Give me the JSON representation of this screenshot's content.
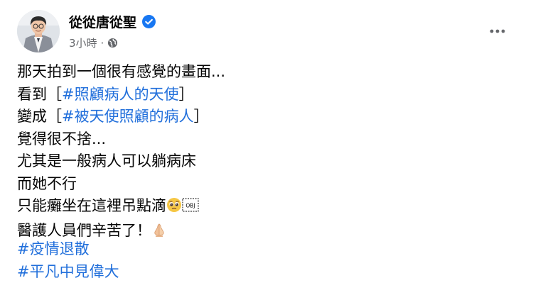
{
  "post": {
    "author": "從從唐從聖",
    "time": "3小時",
    "separator": "·",
    "lines": {
      "l1": "那天拍到一個很有感覺的畫面...",
      "l2_prefix": "看到［",
      "l2_tag": "#照顧病人的天使",
      "l2_suffix": "］",
      "l3_prefix": "變成［",
      "l3_tag": "#被天使照顧的病人",
      "l3_suffix": "］",
      "l4": "覺得很不捨...",
      "l5": "尤其是一般病人可以躺病床",
      "l6": "而她不行",
      "l7": "只能癱坐在這裡吊點滴",
      "l7_obj": "OBJ",
      "l8": "醫護人員們辛苦了！"
    },
    "hashtags": [
      "#疫情退散",
      "#平凡中見偉大"
    ],
    "icons": {
      "verified": "verified-badge-icon",
      "audience": "globe-icon",
      "more": "more-options-icon",
      "emoji_sad": "pleading-face-emoji",
      "emoji_pray": "folded-hands-emoji"
    },
    "colors": {
      "hashtag": "#216fdb",
      "verified": "#1877f2",
      "meta": "#65676b"
    }
  }
}
